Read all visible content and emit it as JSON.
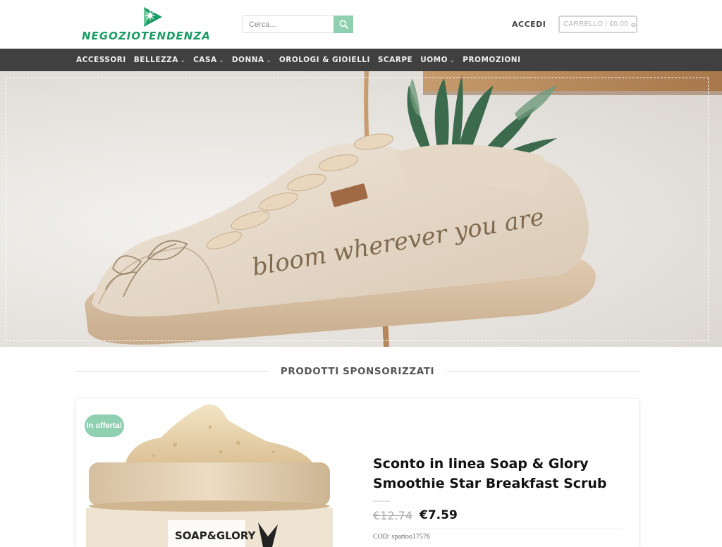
{
  "header": {
    "logo_text": "NEGOZIOTENDENZA",
    "search": {
      "placeholder": "Cerca..."
    },
    "login_label": "ACCEDI",
    "cart_label": "CARRELLO / €0.00"
  },
  "nav": {
    "items": [
      {
        "label": "ACCESSORI",
        "has_dropdown": false
      },
      {
        "label": "BELLEZZA",
        "has_dropdown": true
      },
      {
        "label": "CASA",
        "has_dropdown": true
      },
      {
        "label": "DONNA",
        "has_dropdown": true
      },
      {
        "label": "OROLOGI & GIOIELLI",
        "has_dropdown": false
      },
      {
        "label": "SCARPE",
        "has_dropdown": false
      },
      {
        "label": "UOMO",
        "has_dropdown": true
      },
      {
        "label": "PROMOZIONI",
        "has_dropdown": false
      }
    ]
  },
  "hero": {
    "handwriting": "bloom wherever you are"
  },
  "section": {
    "title": "PRODOTTI SPONSORIZZATI"
  },
  "product": {
    "badge": "In offerta!",
    "title": "Sconto in linea Soap & Glory Smoothie Star Breakfast Scrub",
    "old_price": "€12.74",
    "new_price": "€7.59",
    "sku": "COD: spartoo17576",
    "jar_brand": "SOAP&GLORY"
  },
  "colors": {
    "brand_green": "#1a9c64",
    "accent_mint": "#8fd0b1",
    "nav_bg": "#404040"
  },
  "icons": {
    "search": "search-icon",
    "cart": "shopping-bag-icon",
    "chevron": "chevron-down-icon",
    "logo": "play-triangle-logo-icon"
  }
}
